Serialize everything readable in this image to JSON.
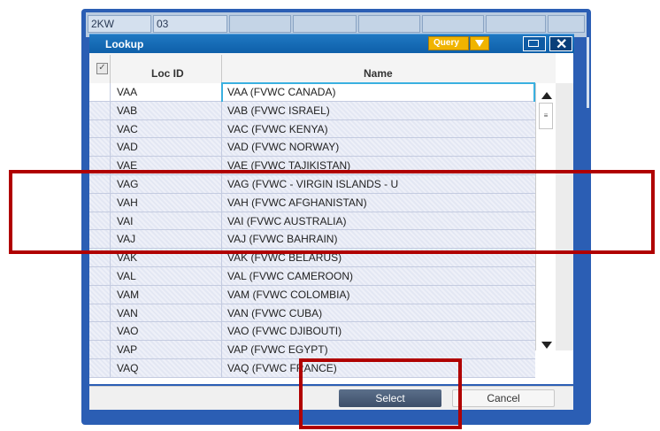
{
  "background_grid": {
    "cell1": "2KW",
    "cell2": "03"
  },
  "dialog": {
    "title": "Lookup",
    "query_label": "Query",
    "columns": {
      "loc_id": "Loc ID",
      "name": "Name"
    },
    "rows": [
      {
        "loc": "VAA",
        "name": "VAA (FVWC CANADA)"
      },
      {
        "loc": "VAB",
        "name": "VAB (FVWC ISRAEL)"
      },
      {
        "loc": "VAC",
        "name": "VAC (FVWC KENYA)"
      },
      {
        "loc": "VAD",
        "name": "VAD (FVWC NORWAY)"
      },
      {
        "loc": "VAE",
        "name": "VAE (FVWC TAJIKISTAN)"
      },
      {
        "loc": "VAG",
        "name": "VAG (FVWC - VIRGIN ISLANDS - U"
      },
      {
        "loc": "VAH",
        "name": "VAH (FVWC AFGHANISTAN)"
      },
      {
        "loc": "VAI",
        "name": "VAI (FVWC AUSTRALIA)"
      },
      {
        "loc": "VAJ",
        "name": "VAJ (FVWC BAHRAIN)"
      },
      {
        "loc": "VAK",
        "name": "VAK (FVWC BELARUS)"
      },
      {
        "loc": "VAL",
        "name": "VAL (FVWC CAMEROON)"
      },
      {
        "loc": "VAM",
        "name": "VAM (FVWC COLOMBIA)"
      },
      {
        "loc": "VAN",
        "name": "VAN (FVWC CUBA)"
      },
      {
        "loc": "VAO",
        "name": "VAO (FVWC DJIBOUTI)"
      },
      {
        "loc": "VAP",
        "name": "VAP (FVWC EGYPT)"
      },
      {
        "loc": "VAQ",
        "name": "VAQ (FVWC FRANCE)"
      }
    ],
    "select_label": "Select",
    "cancel_label": "Cancel"
  },
  "colors": {
    "accent": "#0d5ea8",
    "query": "#f0b400",
    "annotation": "#b00000"
  }
}
